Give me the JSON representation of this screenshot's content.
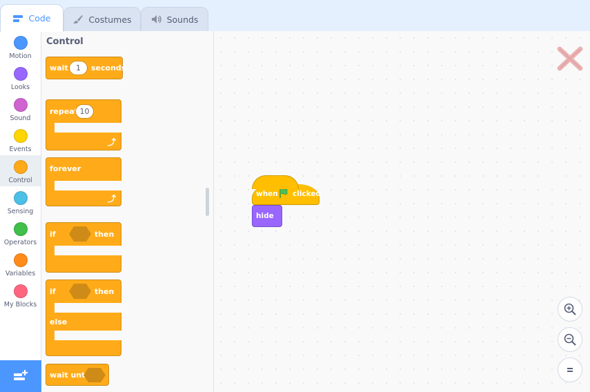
{
  "tabs": [
    {
      "label": "Code",
      "icon": "code-icon",
      "active": true
    },
    {
      "label": "Costumes",
      "icon": "brush-icon",
      "active": false
    },
    {
      "label": "Sounds",
      "icon": "speaker-icon",
      "active": false
    }
  ],
  "categories": [
    {
      "label": "Motion",
      "color": "#4c97ff"
    },
    {
      "label": "Looks",
      "color": "#9966ff"
    },
    {
      "label": "Sound",
      "color": "#cf63cf"
    },
    {
      "label": "Events",
      "color": "#ffd500"
    },
    {
      "label": "Control",
      "color": "#ffab19",
      "selected": true
    },
    {
      "label": "Sensing",
      "color": "#4cbfe6"
    },
    {
      "label": "Operators",
      "color": "#40bf4a"
    },
    {
      "label": "Variables",
      "color": "#ff8c1a"
    },
    {
      "label": "My Blocks",
      "color": "#ff6680"
    }
  ],
  "palette": {
    "title": "Control",
    "wait": {
      "label": "wait",
      "value": "1",
      "suffix": "seconds"
    },
    "repeat": {
      "label": "repeat",
      "value": "10"
    },
    "forever": {
      "label": "forever"
    },
    "if_then": {
      "if": "if",
      "then": "then"
    },
    "if_else": {
      "if": "if",
      "then": "then",
      "else": "else"
    },
    "wait_until": {
      "label": "wait until"
    }
  },
  "workspace": {
    "hat": {
      "when": "when",
      "clicked": "clicked"
    },
    "hide": {
      "label": "hide"
    }
  },
  "colors": {
    "control": "#ffab19",
    "events": "#ffbf00",
    "looks": "#9966ff",
    "accent": "#4c97ff"
  }
}
